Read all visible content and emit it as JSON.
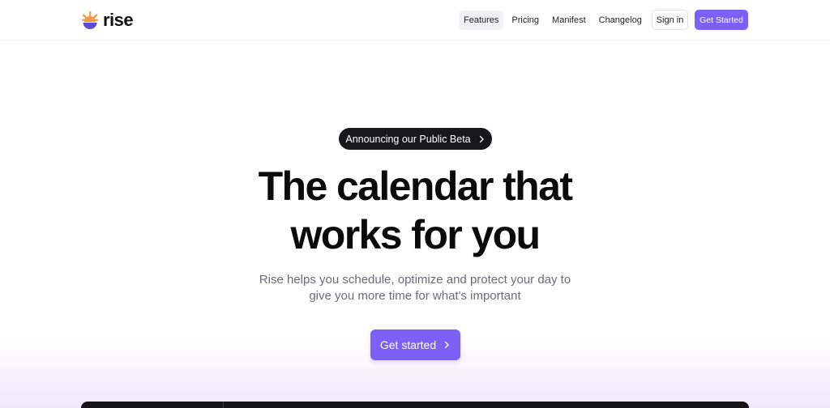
{
  "brand": {
    "name": "rise",
    "logo_icon": "sunrise-logo-icon",
    "colors": {
      "orange": "#f2994a",
      "purple": "#5b4bd6"
    }
  },
  "nav": {
    "items": [
      {
        "label": "Features",
        "active": true
      },
      {
        "label": "Pricing",
        "active": false
      },
      {
        "label": "Manifest",
        "active": false
      },
      {
        "label": "Changelog",
        "active": false
      }
    ],
    "signin_label": "Sign in",
    "cta_label": "Get Started"
  },
  "hero": {
    "announcement": "Announcing our Public Beta",
    "announcement_icon": "chevron-right-icon",
    "title_line1": "The calendar that",
    "title_line2": "works for you",
    "subtitle_line1": "Rise helps you schedule, optimize and protect your day to",
    "subtitle_line2": "give you more time for what's important",
    "cta_label": "Get started",
    "cta_icon": "chevron-right-icon"
  },
  "theme": {
    "accent": "#7b61f6",
    "dark": "#18181b",
    "muted_text": "#6b6b75"
  }
}
